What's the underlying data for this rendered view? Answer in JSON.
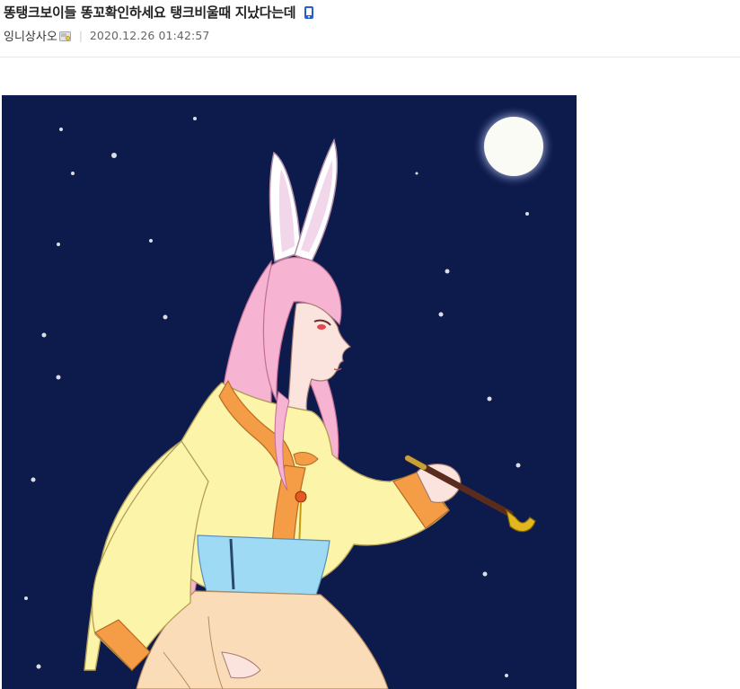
{
  "post": {
    "title": "똥탱크보이들 똥꼬확인하세요 탱크비울때 지났다는데",
    "mobile_icon": "mobile-phone-icon",
    "author": "잉니상사오",
    "author_icon": "gallog-icon",
    "separator": "|",
    "datetime": "2020.12.26 01:42:57"
  },
  "image": {
    "subject": "moon-rabbit-girl-illustration",
    "colors": {
      "sky": "#0c1a4c",
      "moon": "#fbfbf6",
      "hair": "#f6b3d2",
      "jeogori": "#fbf4a9",
      "trim": "#f59d46",
      "sash": "#9fdaf4",
      "skirt": "#fbdcb9"
    }
  }
}
